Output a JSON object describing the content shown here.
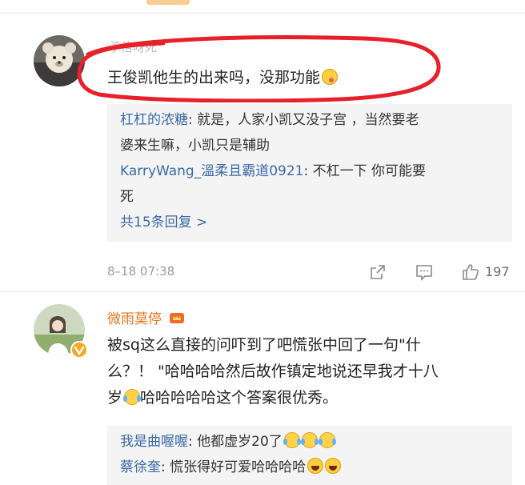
{
  "comments": [
    {
      "username": "予倍呀死",
      "text": "王俊凯他生的出来吗，没那功能",
      "emoji": "yum-face-icon",
      "replies": [
        {
          "user": "杠杠的浓糖",
          "text": ": 就是，人家小凯又没子宫 ，当然要老",
          "text2": "婆来生嘛，小凯只是辅助"
        },
        {
          "user": "KarryWang_溫柔且霸道0921",
          "text": ": 不杠一下 你可能要",
          "text2": "死"
        }
      ],
      "more_replies": "共15条回复 >",
      "timestamp": "8–18 07:38",
      "likes": "197"
    },
    {
      "username": "微雨莫停",
      "text_line1": "被sq这么直接的问吓到了吧慌张中回了一句\"什",
      "text_line2": "么？！ \"哈哈哈哈然后故作镇定地说还早我才十八",
      "text_line3a": "岁",
      "text_line3b": "哈哈哈哈哈这个答案很优秀。",
      "replies": [
        {
          "user": "我是曲喔喔",
          "text": ": 他都虚岁20了"
        },
        {
          "user": "蔡徐奎",
          "text": ": 慌张得好可爱哈哈哈哈"
        }
      ]
    }
  ],
  "colors": {
    "username": "#e8751a",
    "reply_user": "#3d6aa8",
    "highlight": "#e8202a",
    "reply_bg": "#f4f4f4"
  }
}
